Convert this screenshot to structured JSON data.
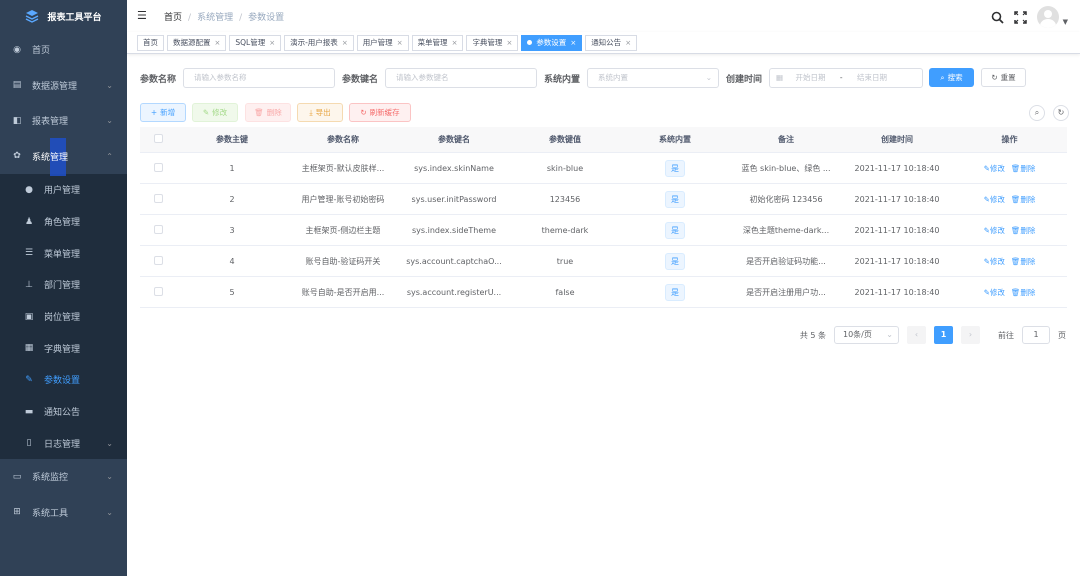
{
  "app": {
    "title": "报表工具平台"
  },
  "sidebar": {
    "items": [
      {
        "label": "首页",
        "icon": "dashboard-icon",
        "arrow": false
      },
      {
        "label": "数据源管理",
        "icon": "database-icon",
        "arrow": true
      },
      {
        "label": "报表管理",
        "icon": "report-icon",
        "arrow": true
      },
      {
        "label": "系统管理",
        "icon": "gear-icon",
        "arrow": true,
        "open": true
      }
    ],
    "sub": [
      {
        "label": "用户管理",
        "icon": "user-icon"
      },
      {
        "label": "角色管理",
        "icon": "peoples-icon"
      },
      {
        "label": "菜单管理",
        "icon": "tree-icon"
      },
      {
        "label": "部门管理",
        "icon": "org-icon"
      },
      {
        "label": "岗位管理",
        "icon": "post-icon"
      },
      {
        "label": "字典管理",
        "icon": "dict-icon"
      },
      {
        "label": "参数设置",
        "icon": "edit-icon",
        "current": true
      },
      {
        "label": "通知公告",
        "icon": "message-icon"
      },
      {
        "label": "日志管理",
        "icon": "log-icon",
        "arrow": true
      }
    ],
    "bottom": [
      {
        "label": "系统监控",
        "icon": "monitor-icon"
      },
      {
        "label": "系统工具",
        "icon": "tool-icon"
      }
    ]
  },
  "breadcrumb": [
    "首页",
    "系统管理",
    "参数设置"
  ],
  "tags": [
    {
      "label": "首页",
      "close": false
    },
    {
      "label": "数据源配置",
      "close": true
    },
    {
      "label": "SQL管理",
      "close": true
    },
    {
      "label": "演示-用户报表",
      "close": true
    },
    {
      "label": "用户管理",
      "close": true
    },
    {
      "label": "菜单管理",
      "close": true
    },
    {
      "label": "字典管理",
      "close": true
    },
    {
      "label": "参数设置",
      "close": true,
      "active": true
    },
    {
      "label": "通知公告",
      "close": true
    }
  ],
  "search": {
    "name_label": "参数名称",
    "name_placeholder": "请输入参数名称",
    "key_label": "参数键名",
    "key_placeholder": "请输入参数键名",
    "type_label": "系统内置",
    "type_placeholder": "系统内置",
    "time_label": "创建时间",
    "start_placeholder": "开始日期",
    "end_placeholder": "结束日期",
    "range_sep": "-",
    "search_btn": "搜索",
    "reset_btn": "重置"
  },
  "toolbar": {
    "add": "新增",
    "edit": "修改",
    "delete": "删除",
    "export": "导出",
    "refresh": "刷新缓存"
  },
  "table": {
    "headers": [
      "参数主键",
      "参数名称",
      "参数键名",
      "参数键值",
      "系统内置",
      "备注",
      "创建时间",
      "操作"
    ],
    "rows": [
      {
        "id": "1",
        "name": "主框架页-默认皮肤样...",
        "key": "sys.index.skinName",
        "value": "skin-blue",
        "builtin": "是",
        "remark": "蓝色 skin-blue、绿色 ...",
        "time": "2021-11-17 10:18:40"
      },
      {
        "id": "2",
        "name": "用户管理-账号初始密码",
        "key": "sys.user.initPassword",
        "value": "123456",
        "builtin": "是",
        "remark": "初始化密码 123456",
        "time": "2021-11-17 10:18:40"
      },
      {
        "id": "3",
        "name": "主框架页-侧边栏主题",
        "key": "sys.index.sideTheme",
        "value": "theme-dark",
        "builtin": "是",
        "remark": "深色主题theme-dark...",
        "time": "2021-11-17 10:18:40"
      },
      {
        "id": "4",
        "name": "账号自助-验证码开关",
        "key": "sys.account.captchaO...",
        "value": "true",
        "builtin": "是",
        "remark": "是否开启验证码功能...",
        "time": "2021-11-17 10:18:40"
      },
      {
        "id": "5",
        "name": "账号自助-是否开启用...",
        "key": "sys.account.registerU...",
        "value": "false",
        "builtin": "是",
        "remark": "是否开启注册用户功...",
        "time": "2021-11-17 10:18:40"
      }
    ],
    "op_edit": "修改",
    "op_delete": "删除"
  },
  "pager": {
    "total": "共 5 条",
    "size": "10条/页",
    "current": "1",
    "goto": "前往",
    "goto_value": "1",
    "page_unit": "页"
  },
  "colors": {
    "sidebar": "#304156",
    "submenu": "#1f2d3d",
    "primary": "#409eff"
  }
}
